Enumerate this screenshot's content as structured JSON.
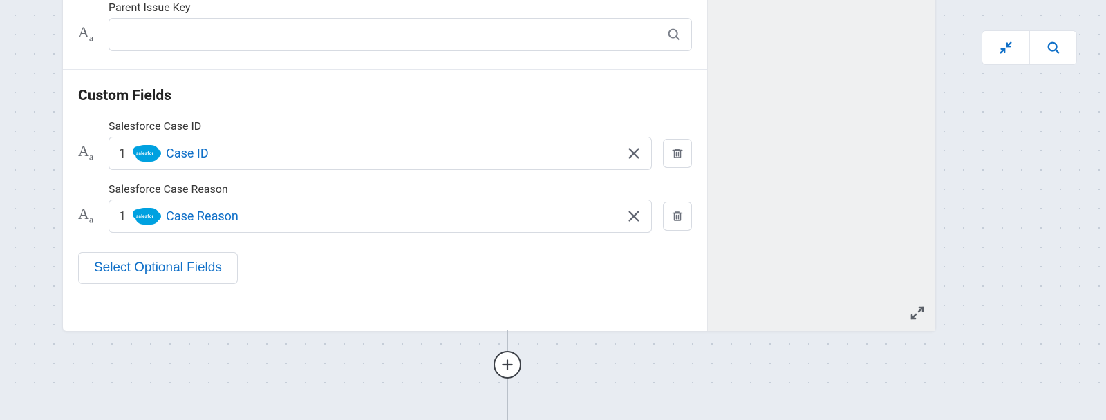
{
  "colors": {
    "link": "#1070c8",
    "sfBlue": "#00a1e0"
  },
  "standard_fields": {
    "parent_issue_key": {
      "label": "Parent Issue Key",
      "value": "",
      "placeholder": ""
    }
  },
  "custom_fields_section": {
    "title": "Custom Fields",
    "fields": [
      {
        "label": "Salesforce Case ID",
        "index": "1",
        "badge": "salesforce",
        "value": "Case ID"
      },
      {
        "label": "Salesforce Case Reason",
        "index": "1",
        "badge": "salesforce",
        "value": "Case Reason"
      }
    ],
    "select_optional_label": "Select Optional Fields"
  },
  "toolbar": {
    "collapse_title": "Collapse",
    "search_title": "Search"
  },
  "connector": {
    "add_title": "Add step"
  }
}
